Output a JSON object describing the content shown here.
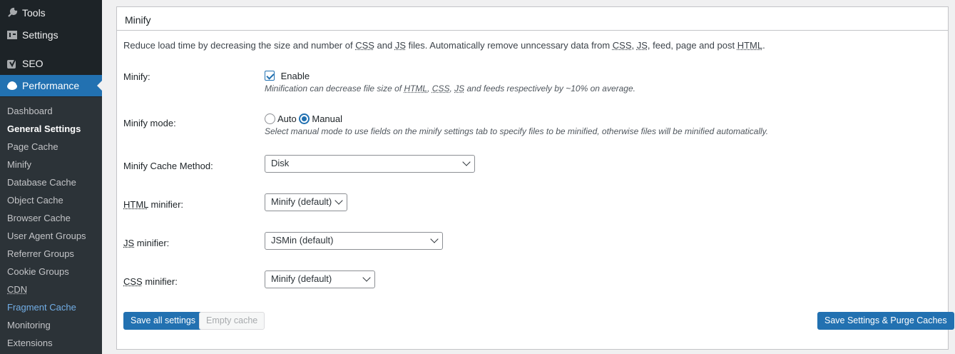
{
  "sidebar": {
    "tools": "Tools",
    "settings": "Settings",
    "seo": "SEO",
    "performance": "Performance",
    "submenu": [
      "Dashboard",
      "General Settings",
      "Page Cache",
      "Minify",
      "Database Cache",
      "Object Cache",
      "Browser Cache",
      "User Agent Groups",
      "Referrer Groups",
      "Cookie Groups",
      "CDN",
      "Fragment Cache",
      "Monitoring",
      "Extensions"
    ]
  },
  "panel": {
    "title": "Minify",
    "description": {
      "p1": "Reduce load time by decreasing the size and number of ",
      "css": "CSS",
      "and": " and ",
      "js": "JS",
      "p2": " files. Automatically remove unncessary data from ",
      "css2": "CSS",
      "comma": ", ",
      "js2": "JS",
      "p3": ", feed, page and post ",
      "html": "HTML",
      "dot": "."
    },
    "minify": {
      "label": "Minify:",
      "enable": "Enable",
      "note_p1": "Minification can decrease file size of ",
      "note_html": "HTML",
      "note_comma": ", ",
      "note_css": "CSS",
      "note_comma2": ", ",
      "note_js": "JS",
      "note_p2": " and feeds respectively by ~10% on average."
    },
    "mode": {
      "label": "Minify mode:",
      "auto": "Auto",
      "manual": "Manual",
      "note": "Select manual mode to use fields on the minify settings tab to specify files to be minified, otherwise files will be minified automatically."
    },
    "cache_method": {
      "label": "Minify Cache Method:",
      "value": "Disk"
    },
    "html_minifier": {
      "abbr": "HTML",
      "label": " minifier:",
      "value": "Minify (default)"
    },
    "js_minifier": {
      "abbr": "JS",
      "label": " minifier:",
      "value": "JSMin (default)"
    },
    "css_minifier": {
      "abbr": "CSS",
      "label": " minifier:",
      "value": "Minify (default)"
    },
    "buttons": {
      "save_all": "Save all settings",
      "empty_cache": "Empty cache",
      "save_purge": "Save Settings & Purge Caches"
    }
  }
}
